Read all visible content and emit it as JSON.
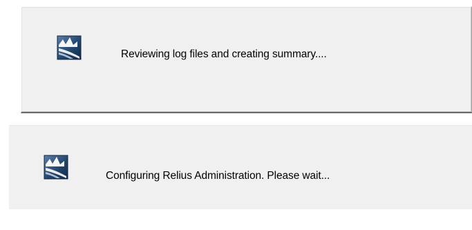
{
  "dialogs": [
    {
      "icon": "relius-logo-icon",
      "message": "Reviewing log files and creating summary...."
    },
    {
      "icon": "relius-logo-icon",
      "message": "Configuring Relius Administration.  Please wait..."
    }
  ],
  "colors": {
    "panel_background": "#f0f0f0",
    "icon_dark": "#1f3f63",
    "icon_light": "#ffffff"
  }
}
